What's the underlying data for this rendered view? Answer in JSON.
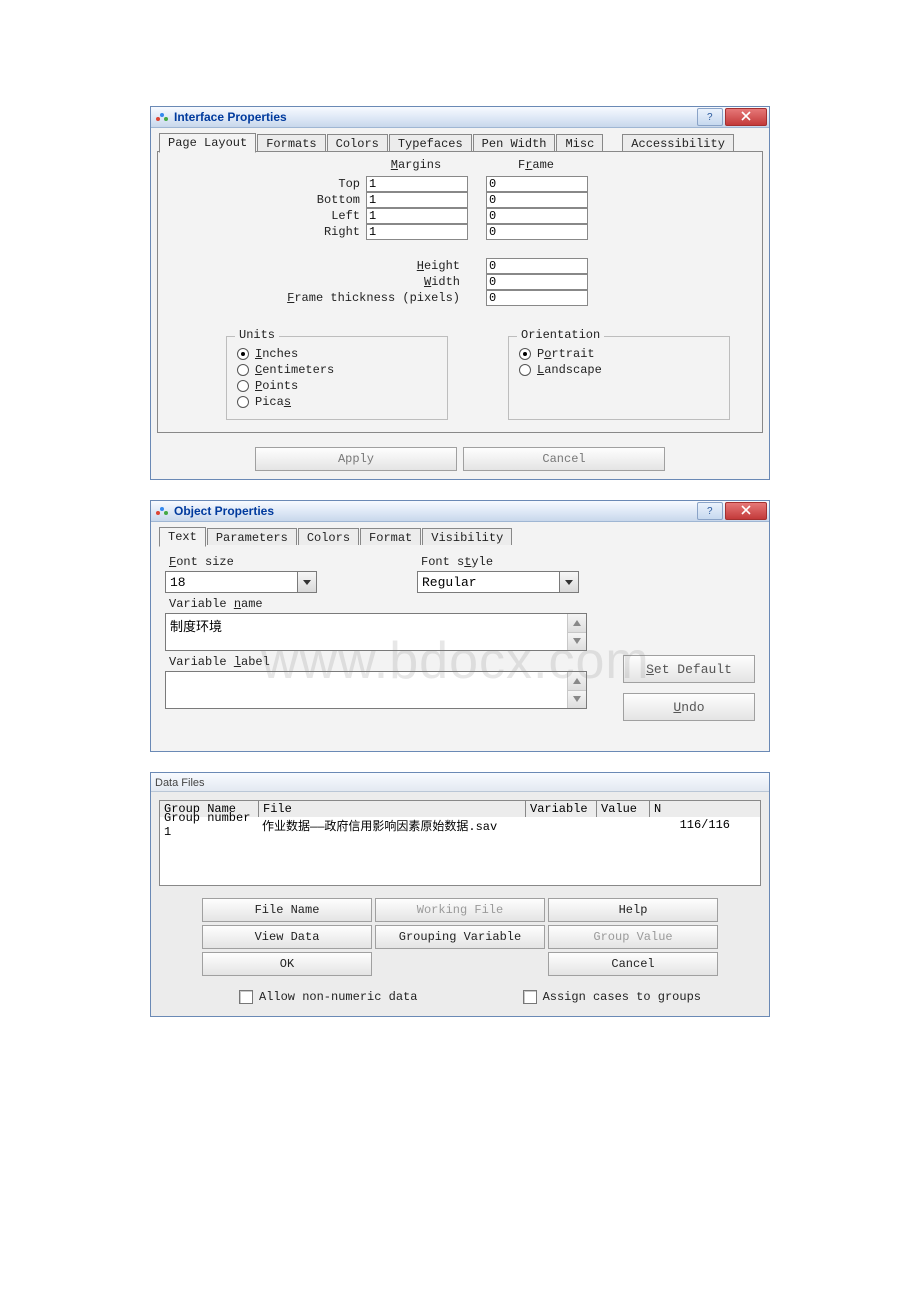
{
  "interface_properties": {
    "title": "Interface Properties",
    "tabs": [
      "Page Layout",
      "Formats",
      "Colors",
      "Typefaces",
      "Pen Width",
      "Misc",
      "Accessibility"
    ],
    "active_tab": 0,
    "margins_header": "Margins",
    "frame_header": "Frame",
    "labels": {
      "top": "Top",
      "bottom": "Bottom",
      "left": "Left",
      "right": "Right",
      "height": "Height",
      "width": "Width",
      "frame_thickness": "Frame thickness (pixels)"
    },
    "margin_values": {
      "top": "1",
      "bottom": "1",
      "left": "1",
      "right": "1"
    },
    "frame_values": {
      "top": "0",
      "bottom": "0",
      "left": "0",
      "right": "0"
    },
    "size_values": {
      "height": "0",
      "width": "0",
      "frame_thickness": "0"
    },
    "units": {
      "legend": "Units",
      "options": [
        "Inches",
        "Centimeters",
        "Points",
        "Picas"
      ],
      "selected": 0
    },
    "orientation": {
      "legend": "Orientation",
      "options": [
        "Portrait",
        "Landscape"
      ],
      "selected": 0
    },
    "buttons": {
      "apply": "Apply",
      "cancel": "Cancel"
    }
  },
  "object_properties": {
    "title": "Object Properties",
    "tabs": [
      "Text",
      "Parameters",
      "Colors",
      "Format",
      "Visibility"
    ],
    "active_tab": 0,
    "font_size_label": "Font size",
    "font_size_value": "18",
    "font_style_label": "Font style",
    "font_style_value": "Regular",
    "variable_name_label": "Variable name",
    "variable_name_value": "制度环境",
    "variable_label_label": "Variable label",
    "variable_label_value": "",
    "set_default": "Set Default",
    "undo": "Undo",
    "watermark": "www.bdocx.com"
  },
  "data_files": {
    "title": "Data Files",
    "headers": [
      "Group Name",
      "File",
      "Variable",
      "Value",
      "N"
    ],
    "rows": [
      {
        "group": "Group number 1",
        "file": "作业数据——政府信用影响因素原始数据.sav",
        "variable": "",
        "value": "",
        "n": "116/116"
      }
    ],
    "buttons": {
      "file_name": "File Name",
      "working_file": "Working File",
      "help": "Help",
      "view_data": "View Data",
      "grouping_variable": "Grouping Variable",
      "group_value": "Group Value",
      "ok": "OK",
      "cancel": "Cancel"
    },
    "checks": {
      "allow_non_numeric": "Allow non-numeric data",
      "assign_cases": "Assign cases to groups"
    }
  }
}
